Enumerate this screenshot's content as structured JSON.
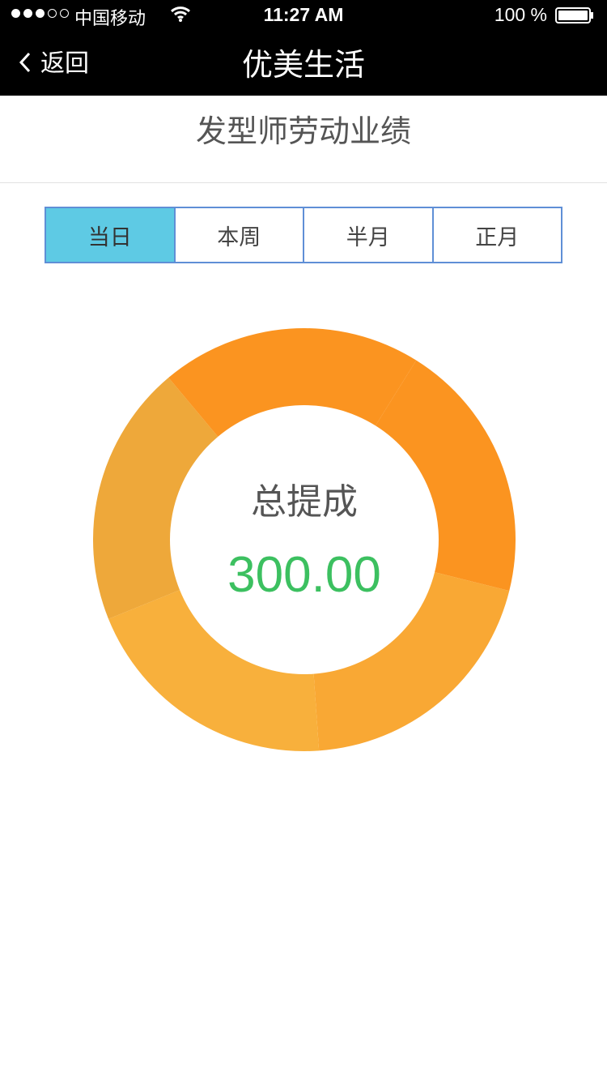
{
  "status_bar": {
    "carrier": "中国移动",
    "time": "11:27 AM",
    "battery": "100 %"
  },
  "nav": {
    "back_label": "返回",
    "title": "优美生活"
  },
  "page": {
    "title": "发型师劳动业绩"
  },
  "tabs": [
    {
      "label": "当日",
      "active": true
    },
    {
      "label": "本周",
      "active": false
    },
    {
      "label": "半月",
      "active": false
    },
    {
      "label": "正月",
      "active": false
    }
  ],
  "summary": {
    "label": "总提成",
    "value": "300.00"
  },
  "colors": {
    "tab_active": "#5ecae4",
    "tab_border": "#5f8fd6",
    "value_green": "#3cc060"
  },
  "chart_data": {
    "type": "pie",
    "segments": [
      {
        "value": 20,
        "color": "#fb9420"
      },
      {
        "value": 20,
        "color": "#f9a834"
      },
      {
        "value": 20,
        "color": "#f8b03c"
      },
      {
        "value": 20,
        "color": "#eea83a"
      },
      {
        "value": 20,
        "color": "#fb9420"
      }
    ],
    "start_angle_deg": -58
  }
}
